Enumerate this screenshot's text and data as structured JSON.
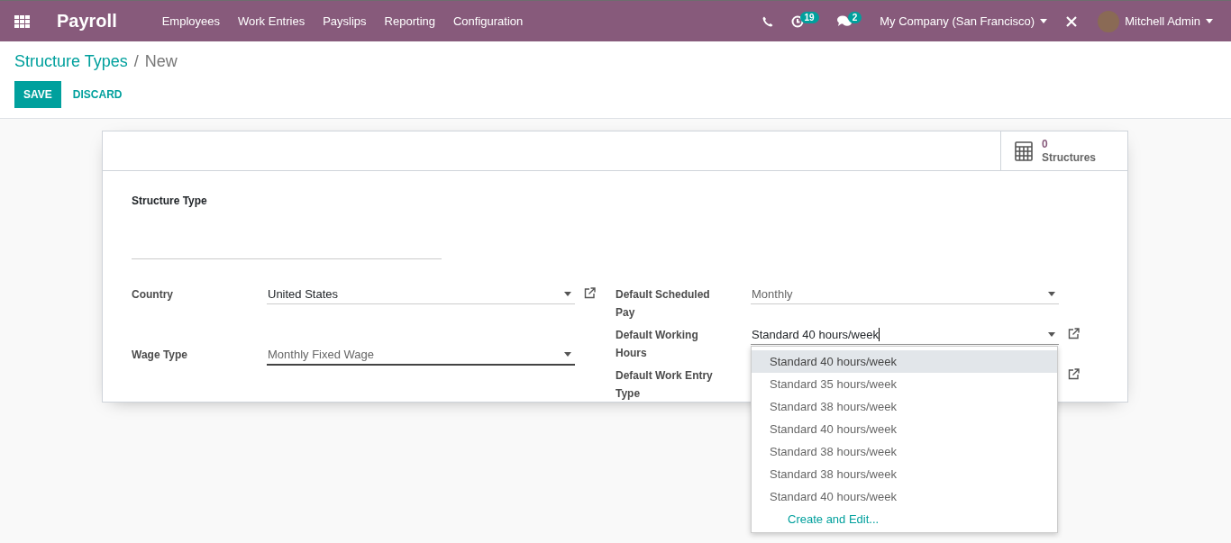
{
  "navbar": {
    "app_name": "Payroll",
    "menu": [
      "Employees",
      "Work Entries",
      "Payslips",
      "Reporting",
      "Configuration"
    ],
    "activities_count": "19",
    "messages_count": "2",
    "company": "My Company (San Francisco)",
    "user": "Mitchell Admin"
  },
  "breadcrumb": {
    "parent": "Structure Types",
    "separator": "/",
    "current": "New"
  },
  "buttons": {
    "save": "SAVE",
    "discard": "DISCARD"
  },
  "stat_button": {
    "value": "0",
    "label": "Structures"
  },
  "name_field": {
    "label": "Structure Type"
  },
  "left_fields": [
    {
      "label": "Country",
      "kind": "many2one",
      "value": "United States",
      "hovered": false,
      "focused": false
    },
    {
      "label": "Wage Type",
      "kind": "selection",
      "value": "Monthly Fixed Wage",
      "hovered": true,
      "focused": false
    }
  ],
  "right_fields": [
    {
      "label": "Default Scheduled Pay",
      "kind": "selection",
      "value": "Monthly",
      "hovered": false,
      "focused": false
    },
    {
      "label": "Default Working Hours",
      "kind": "many2one",
      "value": "Standard 40 hours/week",
      "hovered": false,
      "focused": true,
      "autocomplete": {
        "options": [
          {
            "label": "Standard 40 hours/week",
            "selected": true
          },
          {
            "label": "Standard 35 hours/week",
            "selected": false
          },
          {
            "label": "Standard 38 hours/week",
            "selected": false
          },
          {
            "label": "Standard 40 hours/week",
            "selected": false
          },
          {
            "label": "Standard 38 hours/week",
            "selected": false
          },
          {
            "label": "Standard 38 hours/week",
            "selected": false
          },
          {
            "label": "Standard 40 hours/week",
            "selected": false
          }
        ],
        "create_label": "Create and Edit..."
      }
    },
    {
      "label": "Default Work Entry Type",
      "kind": "many2one"
    }
  ]
}
